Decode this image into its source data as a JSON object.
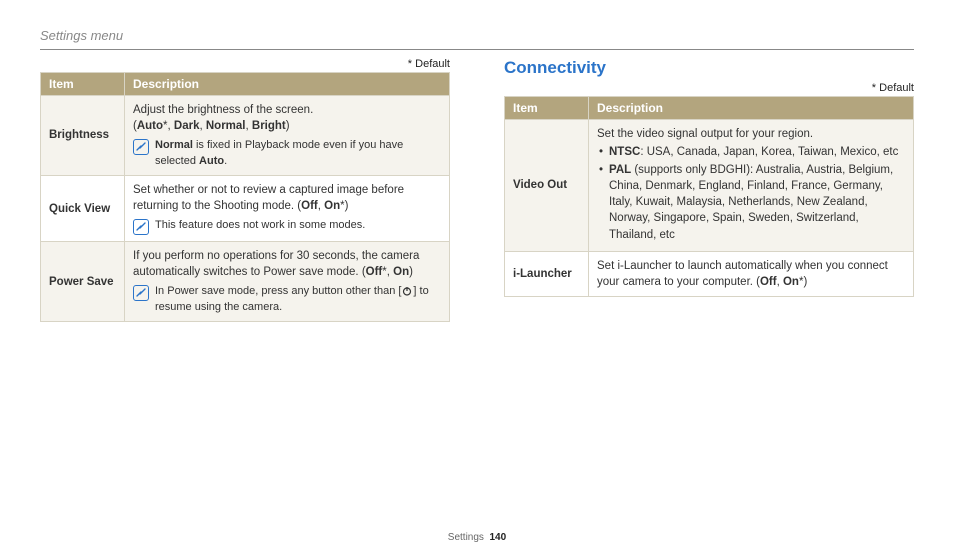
{
  "breadcrumb": "Settings menu",
  "default_label": "* Default",
  "headers": {
    "item": "Item",
    "desc": "Description"
  },
  "left": {
    "rows": [
      {
        "item": "Brightness",
        "para": "Adjust the brightness of the screen.",
        "opts_open": "(",
        "opt1": "Auto",
        "star1": "*",
        "sep": ", ",
        "opt2": "Dark",
        "opt3": "Normal",
        "opt4": "Bright",
        "opts_close": ")",
        "note_pre": "",
        "note_b1": "Normal",
        "note_mid": " is fixed in Playback mode even if you have selected ",
        "note_b2": "Auto",
        "note_post": "."
      },
      {
        "item": "Quick View",
        "para_pre": "Set whether or not to review a captured image before returning to the Shooting mode. (",
        "opt1": "Off",
        "sep": ", ",
        "opt2": "On",
        "star": "*",
        "para_post": ")",
        "note": "This feature does not work in some modes."
      },
      {
        "item": "Power Save",
        "para_pre": "If you perform no operations for 30 seconds, the camera automatically switches to Power save mode. (",
        "opt1": "Off",
        "star1": "*",
        "sep": ", ",
        "opt2": "On",
        "para_post": ")",
        "note_pre": "In Power save mode, press any button other than [",
        "note_post": "] to resume using the camera."
      }
    ]
  },
  "right": {
    "heading": "Connectivity",
    "rows": [
      {
        "item": "Video Out",
        "para": "Set the video signal output for your region.",
        "b1_label": "NTSC",
        "b1_text": ": USA, Canada, Japan, Korea, Taiwan, Mexico, etc",
        "b2_label": "PAL",
        "b2_paren": " (supports only BDGHI)",
        "b2_text": ": Australia, Austria, Belgium, China, Denmark, England, Finland, France, Germany, Italy, Kuwait, Malaysia, Netherlands, New Zealand, Norway, Singapore, Spain, Sweden, Switzerland, Thailand, etc"
      },
      {
        "item": "i-Launcher",
        "para_pre": "Set i-Launcher to launch automatically when you connect your camera to your computer. (",
        "opt1": "Off",
        "sep": ", ",
        "opt2": "On",
        "star": "*",
        "para_post": ")"
      }
    ]
  },
  "footer": {
    "section": "Settings",
    "page": "140"
  }
}
